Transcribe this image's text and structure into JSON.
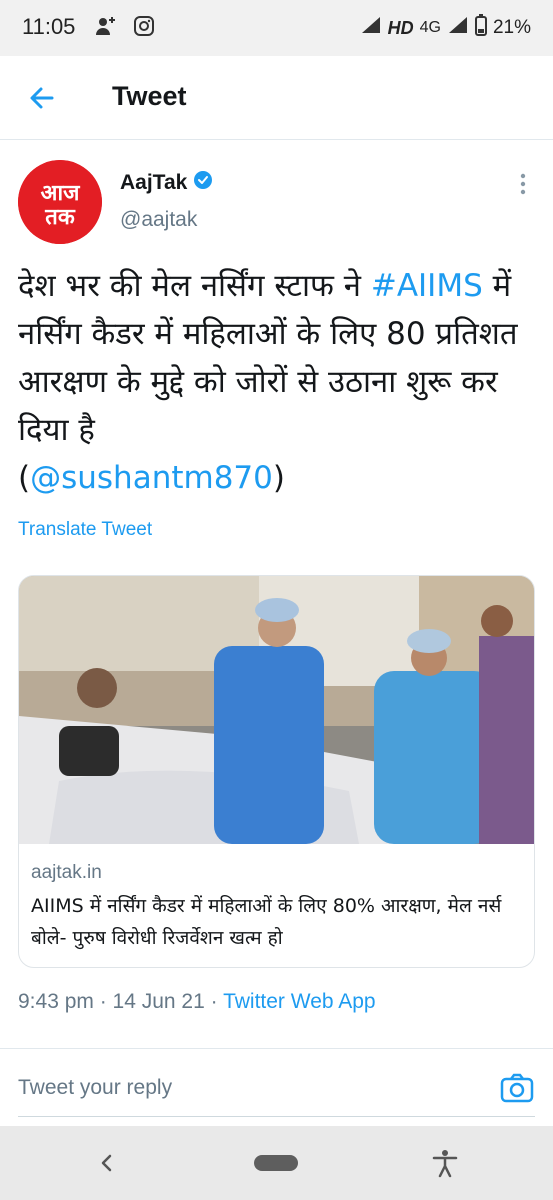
{
  "status_bar": {
    "time": "11:05",
    "network_hd": "HD",
    "network_type": "4G",
    "battery": "21%",
    "icons": [
      "add-contact-icon",
      "instagram-icon",
      "signal-icon",
      "battery-icon"
    ]
  },
  "header": {
    "title": "Tweet",
    "back_icon": "back-arrow-icon"
  },
  "tweet": {
    "author_name": "AajTak",
    "verified": true,
    "author_handle": "@aajtak",
    "avatar_text": "आज तक",
    "text_part1": "देश भर की मेल नर्सिंग स्टाफ ने ",
    "hashtag": "#AIIMS",
    "text_part2": " में नर्सिंग कैडर में महिलाओं के लिए 80 प्रतिशत आरक्षण के मुद्दे को जोरों से उठाना शुरू कर दिया है",
    "mention_open": "(",
    "mention": "@sushantm870",
    "mention_close": ")",
    "translate_label": "Translate Tweet",
    "card": {
      "domain": "aajtak.in",
      "title": "AIIMS में नर्सिंग कैडर में महिलाओं के लिए 80% आरक्षण, मेल नर्स बोले- पुरुष विरोधी रिजर्वेशन खत्म हो"
    },
    "timestamp": "9:43 pm · 14 Jun 21 · ",
    "source_app": "Twitter Web App"
  },
  "reply": {
    "placeholder": "Tweet your reply",
    "camera_icon": "camera-icon"
  },
  "nav_bar": {
    "icons": [
      "nav-back-icon",
      "home-pill-icon",
      "accessibility-icon"
    ]
  },
  "colors": {
    "accent": "#1d9bf0",
    "text_primary": "#14171a",
    "text_secondary": "#657786",
    "brand_red": "#e31e24"
  }
}
